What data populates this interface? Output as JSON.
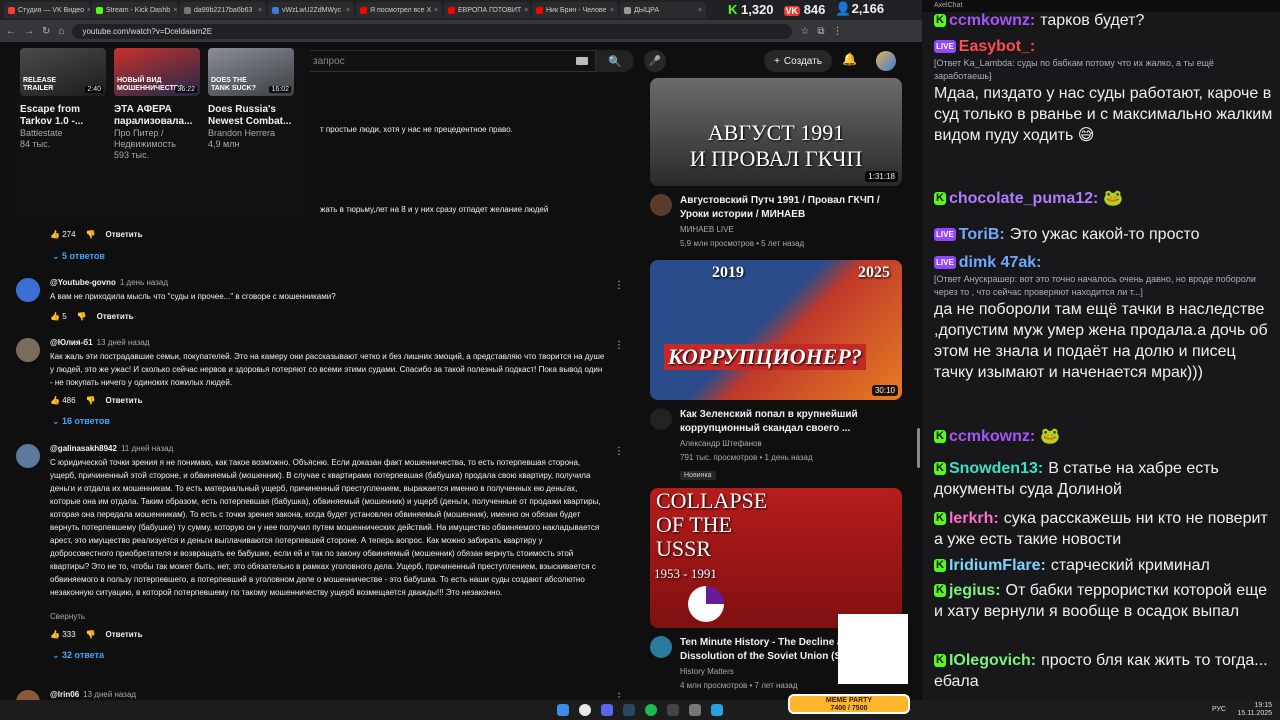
{
  "browser": {
    "tabs": [
      {
        "label": "Студия — VK Видео",
        "color": "#ff3b30"
      },
      {
        "label": "Stream - Kick Dashb",
        "color": "#53fc18"
      },
      {
        "label": "da99b2217ba6b63",
        "color": "#777777"
      },
      {
        "label": "vWzLwU2ZdMWyc",
        "color": "#3a7bd5"
      },
      {
        "label": "Я посмотрел все Х",
        "color": "#ff0000"
      },
      {
        "label": "ЕВРОПА ГОТОВИТ",
        "color": "#ff0000"
      },
      {
        "label": "Ник Брин - Челове",
        "color": "#ff0000"
      },
      {
        "label": "ДЫЦРА",
        "color": "#999999"
      }
    ],
    "url": "youtube.com/watch?v=Dceldaiam2E"
  },
  "stream_stats": {
    "viewers_kick": "1,320",
    "viewers_vk": "846",
    "followers": "2,166"
  },
  "youtube": {
    "search_placeholder": "запрос",
    "create_label": "Создать",
    "miniplayer": [
      {
        "title": "Escape from Tarkov 1.0 -...",
        "channel": "Battlestate",
        "meta": "84 тыс.",
        "duration": "2:40",
        "thumb_text": "RELEASE TRAILER"
      },
      {
        "title": "ЭТА АФЕРА парализовала...",
        "channel": "Про Питер / Недвижимость",
        "meta": "593 тыс.",
        "duration": "36:22",
        "thumb_text": "НОВЫЙ ВИД МОШЕННИЧЕСТВА"
      },
      {
        "title": "Does Russia's Newest Combat...",
        "channel": "Brandon Herrera",
        "meta": "4,9 млн",
        "duration": "16:02",
        "thumb_text": "DOES THE TANK SUCK?"
      }
    ],
    "comments": [
      {
        "author": "",
        "time": "",
        "text": "т простые люди, хотя у нас не прецедентное право.",
        "likes": "",
        "replies": ""
      },
      {
        "author": "",
        "time": "",
        "text": "жать в тюрьму,лет на 8 и у них сразу отпадет желание людей",
        "likes": "274",
        "replies": "5 ответов"
      },
      {
        "author": "@Youtube-govno",
        "time": "1 день назад",
        "text": "А вам не приходила мысль что \"суды и прочее...\" в сговоре с мошенниками?",
        "likes": "5",
        "replies": ""
      },
      {
        "author": "@Юлия-б1",
        "time": "13 дней назад",
        "text": "Как жаль эти пострадавшие семьи, покупателей. Это на камеру они рассказывают четко и без лишних эмоций, а представляю что творится на душе у людей, это же ужас! И сколько сейчас нервов и здоровья потеряют со всеми этими судами. Спасибо за такой полезный подкаст! Пока вывод один - не покупать ничего у одиноких пожилых людей.",
        "likes": "486",
        "replies": "16 ответов"
      },
      {
        "author": "@galinasakh8942",
        "time": "11 дней назад",
        "text": "С юридической точки зрения я не понимаю, как такое возможно. Объясню. Если доказан факт мошенничества, то есть потерпевшая сторона, ущерб, причиненный этой стороне, и обвиняемый (мошенник). В случае с квартирами потерпевшая (бабушка) продала свою квартиру, получила деньги и отдала их мошенникам. То есть материальный ущерб, причиненный преступлением, выражается именно в полученных ею деньгах, которые она им отдала. Таким образом, есть потерпевшая (бабушка), обвиняемый (мошенник) и ущерб (деньги, полученные от продажи квартиры, которая она передала мошенникам). То есть с точки зрения закона, когда будет установлен обвиняемый (мошенник), именно он обязан будет вернуть потерпевшему (бабушке) ту сумму, которую он у нее получил путем мошеннических действий. На имущество обвиняемого накладывается арест, это имущество реализуется и деньги выплачиваются потерпевшей стороне. А теперь вопрос. Как можно забирать квартиру у добросовестного приобретателя и возвращать ее бабушке, если ей и так по закону обвиняемый (мошенник) обязан вернуть стоимость этой квартиры? Это не то, чтобы так может быть, нет, это  обязательно в рамках уголовного дела. Ущерб, причиненный преступлением, взыскивается с обвиняемого в пользу потерпевшего, а потерпевший в уголовном деле о мошенничестве - это бабушка. То есть наши суды создают абсолютно незаконную ситуацию, в которой потерпевшему по такому мошенничеству ущерб возмещается дважды!!! Это незаконно.",
        "likes": "333",
        "replies": "32 ответа",
        "collapse": "Свернуть"
      },
      {
        "author": "@lrin06",
        "time": "13 дней назад",
        "text": "",
        "likes": "",
        "replies": ""
      }
    ],
    "reply_label": "Ответить",
    "recommendations": [
      {
        "thumb_line1": "АВГУСТ 1991",
        "thumb_line2": "И ПРОВАЛ ГКЧП",
        "duration": "1:31:18",
        "title": "Августовский Путч 1991 / Провал ГКЧП / Уроки истории / МИНАЕВ",
        "channel": "МИНАЕВ LIVE",
        "meta": "5,9 млн просмотров • 5 лет назад",
        "badge": ""
      },
      {
        "thumb_line1": "2019",
        "thumb_line2": "2025",
        "thumb_line3": "КОРРУПЦИОНЕР?",
        "duration": "30:10",
        "title": "Как Зеленский попал в крупнейший коррупционный скандал своего ...",
        "channel": "Александр Штефанов",
        "meta": "791 тыс. просмотров • 1 день назад",
        "badge": "Новинка"
      },
      {
        "thumb_line1": "COLLAPSE",
        "thumb_line2": "OF THE",
        "thumb_line3": "USSR",
        "thumb_line4": "1953 - 1991",
        "duration": "",
        "title": "Ten Minute History - The Decline and Dissolution of the Soviet Union (Sho",
        "channel": "History Matters",
        "meta": "4 млн просмотров • 7 лет назад",
        "badge": ""
      }
    ]
  },
  "chat": {
    "window_title": "AxelChat",
    "messages": [
      {
        "platform": "kick",
        "user": "ccmkownz:",
        "user_color": "#a855f7",
        "quote": "",
        "text": "тарков будет?"
      },
      {
        "platform": "live",
        "user": "Easybot_:",
        "user_color": "#ff4d4d",
        "quote": "[Ответ Ka_Lambda: суды по бабкам потому что их жалко, а ты ещё заработаешь]",
        "text": "Мдаа, пиздато у нас суды работают, кароче в суд только в рванье и с максимально жалким видом пуду ходить 😅"
      },
      {
        "platform": "kick",
        "user": "chocolate_puma12:",
        "user_color": "#b07cff",
        "quote": "",
        "text": "🐸"
      },
      {
        "platform": "live",
        "user": "ToriB:",
        "user_color": "#6fa8ff",
        "quote": "",
        "text": "Это ужас какой-то просто"
      },
      {
        "platform": "live",
        "user": "dimk 47ak:",
        "user_color": "#6fa8ff",
        "quote": "[Ответ Анускрашер: вот это точно началось очень давно, но вроде побороли через то , что сейчас проверяют находится ли т...]",
        "text": "да не побороли там ещё тачки в наследстве ,допустим муж умер жена продала.а дочь об этом не знала и подаёт на долю и писец тачку изымают и наченается мрак)))"
      },
      {
        "platform": "kick",
        "user": "ccmkownz:",
        "user_color": "#a855f7",
        "quote": "",
        "text": "🐸"
      },
      {
        "platform": "kick",
        "user": "Snowden13:",
        "user_color": "#3fe0c5",
        "quote": "",
        "text": "В статье на хабре есть документы суда Долиной"
      },
      {
        "platform": "kick",
        "user": "lerkrh:",
        "user_color": "#ff6ec7",
        "quote": "",
        "text": "сука расскажешь ни кто не поверит а уже есть такие новости"
      },
      {
        "platform": "kick",
        "user": "IridiumFlare:",
        "user_color": "#7fd3ff",
        "quote": "",
        "text": "старческий криминал"
      },
      {
        "platform": "kick",
        "user": "jegius:",
        "user_color": "#7cf27c",
        "quote": "",
        "text": "От бабки террористки которой еще и хату вернули я вообще в осадок выпал"
      },
      {
        "platform": "kick",
        "user": "IOlegovich:",
        "user_color": "#7cf27c",
        "quote": "",
        "text": "просто бля как жить то тогда... ебала"
      }
    ]
  },
  "overlay": {
    "meme_title": "MEME PARTY",
    "meme_progress": "7400 / 7500"
  },
  "taskbar": {
    "lang": "РУС",
    "time": "19:15",
    "date": "15.11.2025"
  }
}
